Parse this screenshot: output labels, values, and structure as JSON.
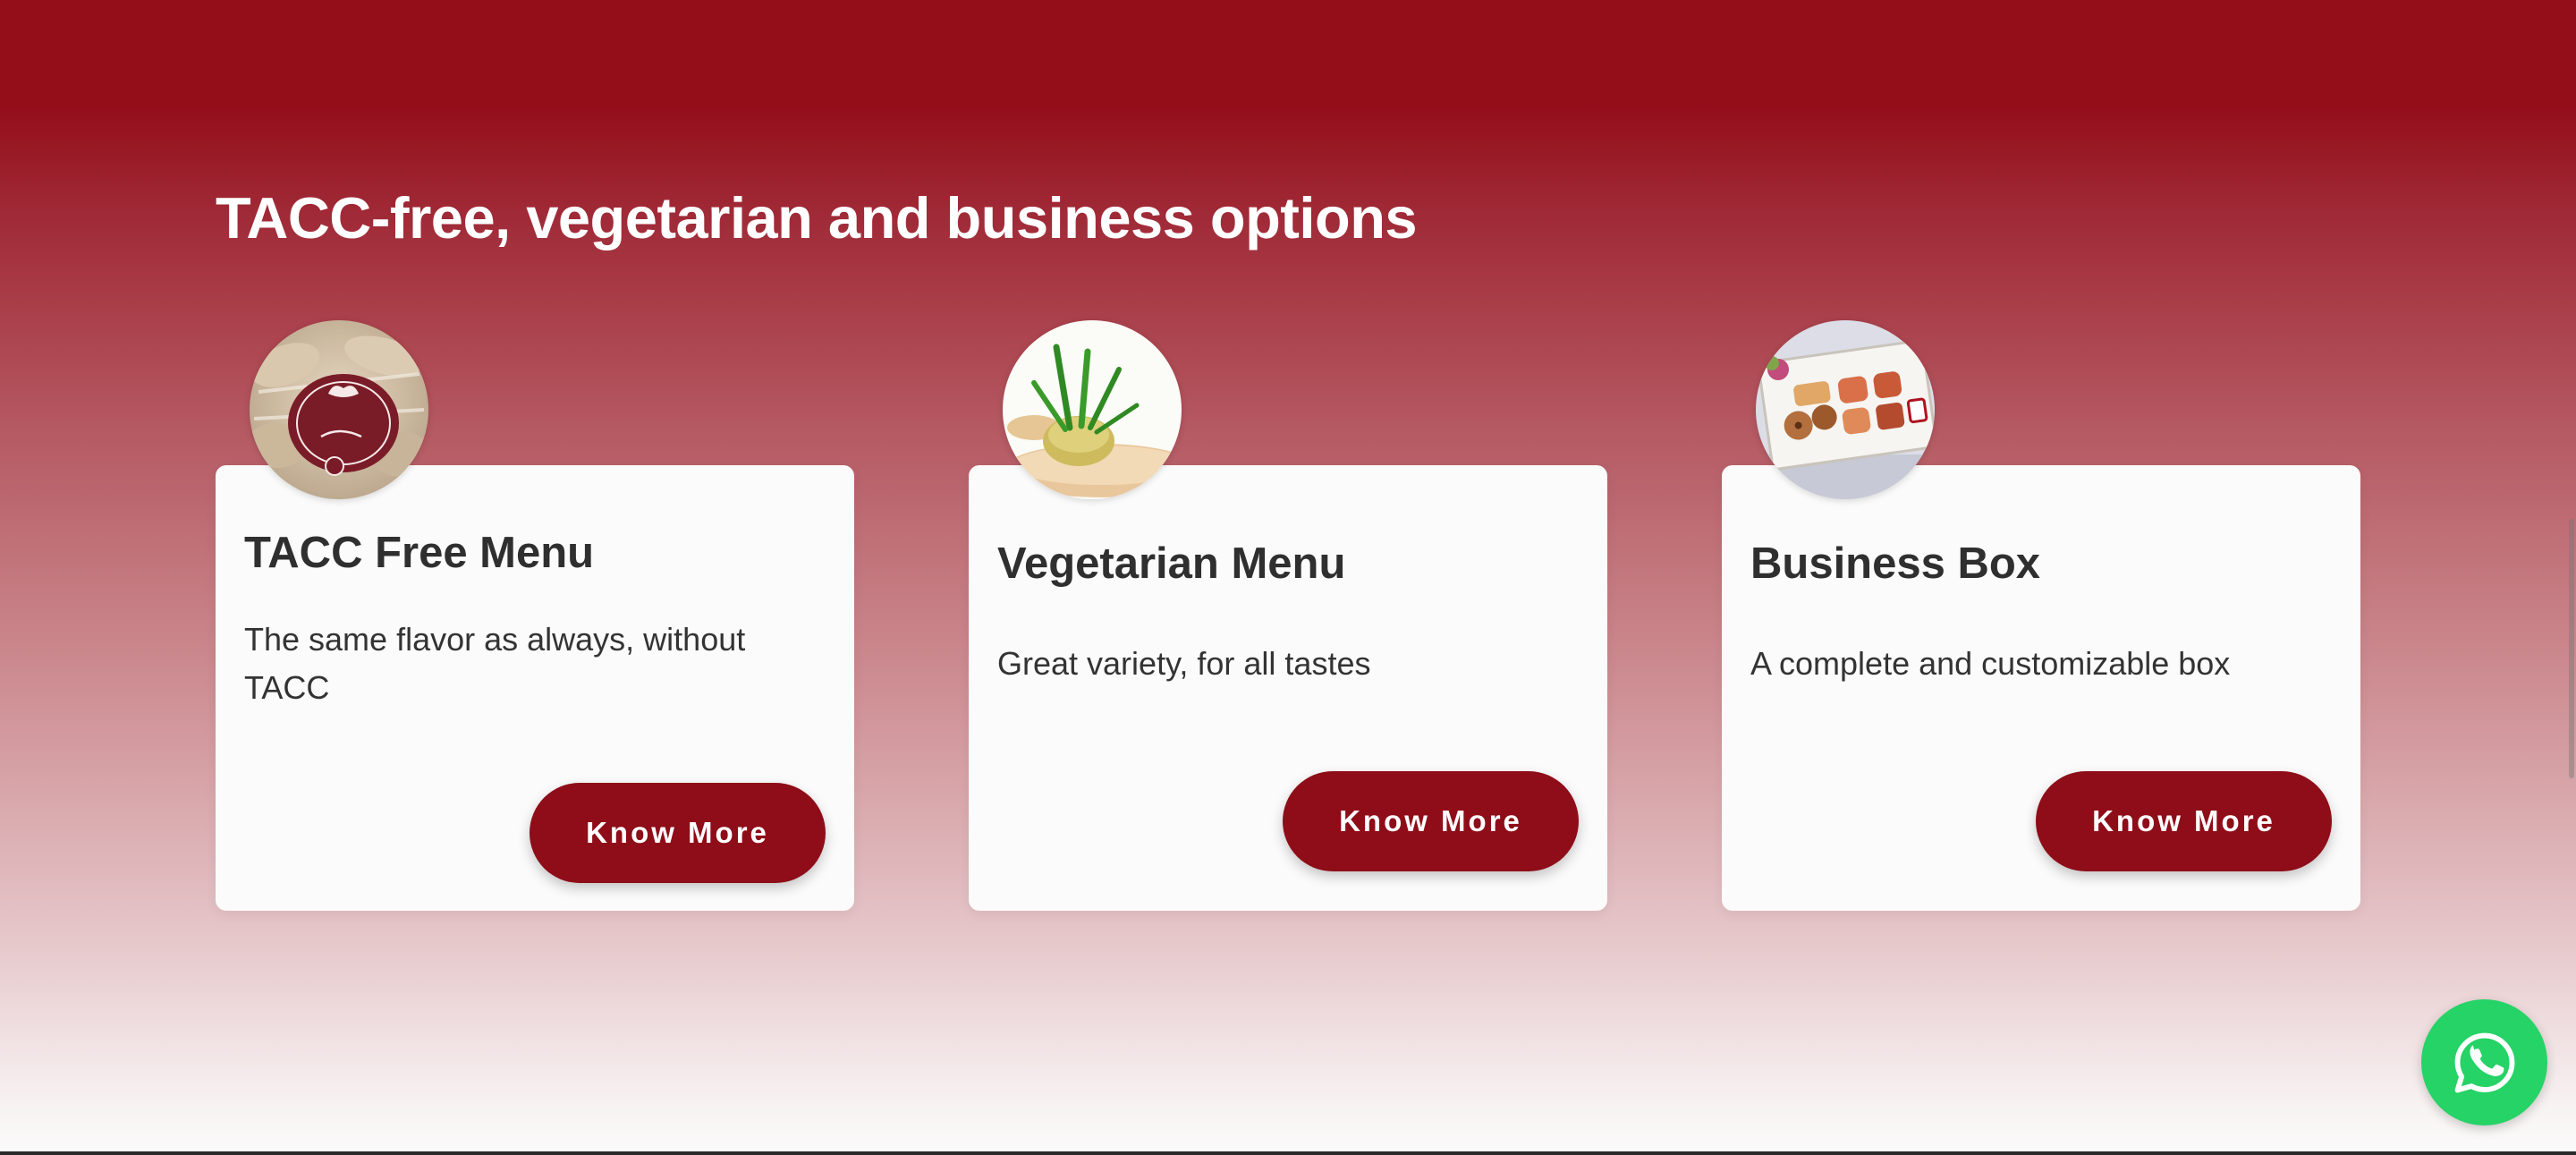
{
  "section": {
    "title": "TACC-free, vegetarian and business options"
  },
  "cards": [
    {
      "title": "TACC Free Menu",
      "description": "The same flavor as always, without TACC",
      "button_label": "Know More",
      "image_icon": "tacc-free-pastries-photo"
    },
    {
      "title": "Vegetarian Menu",
      "description": "Great variety, for all tastes",
      "button_label": "Know More",
      "image_icon": "vegetarian-appetizer-photo"
    },
    {
      "title": "Business Box",
      "description": "A complete and customizable box",
      "button_label": "Know More",
      "image_icon": "business-box-photo"
    }
  ],
  "floating": {
    "icon": "whatsapp-icon"
  },
  "colors": {
    "accent": "#8e0d18",
    "header_red": "#940e1a",
    "card_background": "#fbfbfb",
    "whatsapp_green": "#25d366"
  }
}
